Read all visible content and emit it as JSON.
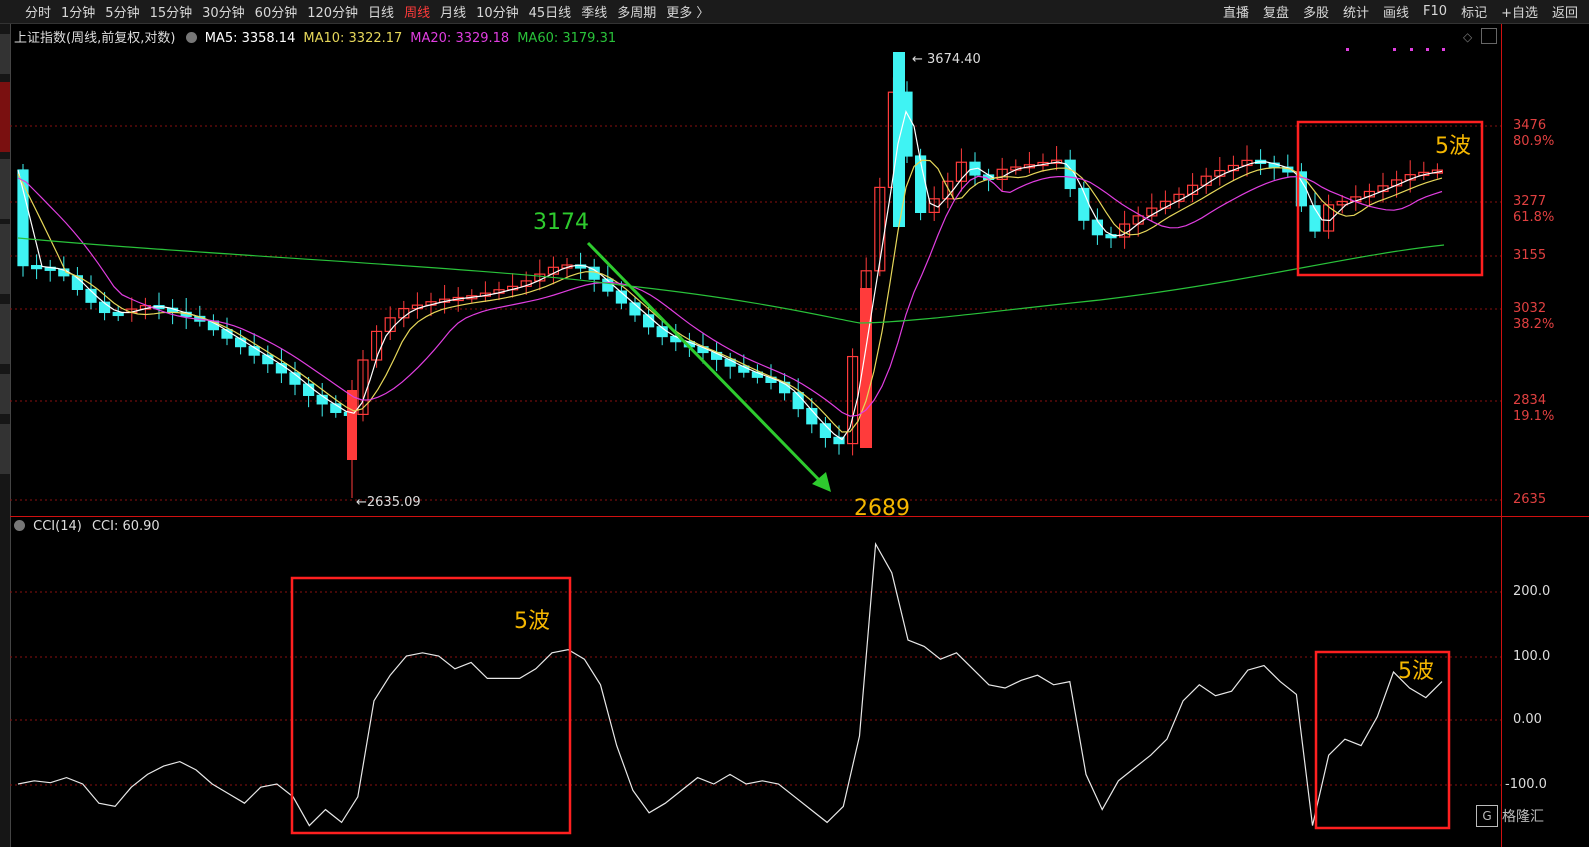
{
  "toolbar": {
    "periods": [
      "分时",
      "1分钟",
      "5分钟",
      "15分钟",
      "30分钟",
      "60分钟",
      "120分钟",
      "日线",
      "周线",
      "月线",
      "10分钟",
      "45日线",
      "季线",
      "多周期",
      "更多 〉"
    ],
    "active_period": "周线",
    "actions": [
      "直播",
      "复盘",
      "多股",
      "统计",
      "画线",
      "F10",
      "标记",
      "+自选",
      "返回"
    ]
  },
  "main_chart": {
    "title": "上证指数(周线,前复权,对数)",
    "ma": [
      {
        "label": "MA5:",
        "value": "3358.14",
        "color": "#ffffff"
      },
      {
        "label": "MA10:",
        "value": "3322.17",
        "color": "#e6d75a"
      },
      {
        "label": "MA20:",
        "value": "3329.18",
        "color": "#e03ee0"
      },
      {
        "label": "MA60:",
        "value": "3179.31",
        "color": "#29c23a"
      }
    ],
    "y_labels": [
      {
        "price": "3476",
        "pct": "80.9%"
      },
      {
        "price": "3277",
        "pct": "61.8%"
      },
      {
        "price": "3155",
        "pct": ""
      },
      {
        "price": "3032",
        "pct": "38.2%"
      },
      {
        "price": "2834",
        "pct": "19.1%"
      },
      {
        "price": "2635",
        "pct": ""
      }
    ],
    "high_label": "3674.40",
    "low_label": "2635.09",
    "annotations": {
      "peak": "3174",
      "trough": "2689",
      "wave_main": "5波"
    }
  },
  "cci_chart": {
    "title": "CCI(14)",
    "value_label": "CCI: 60.90",
    "y_labels": [
      "200.0",
      "100.0",
      "0.00",
      "-100.0"
    ],
    "wave_labels": [
      "5波",
      "5波"
    ],
    "values": [
      -100,
      -95,
      -98,
      -90,
      -100,
      -130,
      -135,
      -105,
      -85,
      -72,
      -65,
      -78,
      -100,
      -115,
      -130,
      -105,
      -100,
      -120,
      -165,
      -140,
      -160,
      -120,
      30,
      70,
      100,
      105,
      100,
      80,
      90,
      65,
      65,
      65,
      80,
      105,
      110,
      95,
      55,
      -40,
      -110,
      -145,
      -130,
      -110,
      -90,
      -100,
      -85,
      -100,
      -95,
      -100,
      -120,
      -140,
      -160,
      -135,
      -25,
      275,
      230,
      125,
      115,
      95,
      105,
      80,
      55,
      50,
      62,
      70,
      55,
      60,
      -85,
      -140,
      -95,
      -75,
      -55,
      -30,
      30,
      55,
      38,
      45,
      78,
      85,
      60,
      40,
      -165,
      -55,
      -30,
      -40,
      5,
      75,
      50,
      35,
      60
    ]
  },
  "brand": "格隆汇",
  "colors": {
    "up": "#ff3b3b",
    "down": "#3ff3f3",
    "ma5": "#ffffff",
    "ma10": "#e6d75a",
    "ma20": "#e03ee0",
    "ma60": "#29c23a",
    "annotation": "#f5b700",
    "box": "#ff2020",
    "green_label": "#2ecb2e"
  }
}
